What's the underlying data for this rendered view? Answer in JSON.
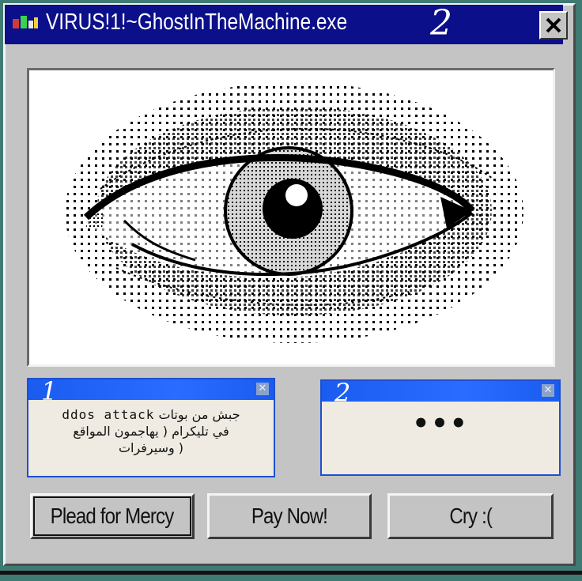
{
  "window": {
    "title": "VIRUS!1!~GhostInTheMachine.exe",
    "title_number": "2",
    "close_label": "✕"
  },
  "icons": {
    "app": "app-icon",
    "close": "close-icon",
    "eye": "eye-image"
  },
  "messages": [
    {
      "number": "1",
      "close": "✕",
      "line1_latin": "ddos attack",
      "line1_arabic": "جبش من بوتات",
      "line2": "في تليكرام ( يهاجمون المواقع",
      "line3": "وسيرفرات )"
    },
    {
      "number": "2",
      "close": "✕",
      "text": "•••"
    }
  ],
  "buttons": {
    "plead": "Plead for Mercy",
    "pay": "Pay Now!",
    "cry": "Cry :("
  },
  "colors": {
    "desktop": "#3f7a73",
    "titlebar": "#0c0f8a",
    "window": "#c4c4c4",
    "message_bar": "#1a5cf0"
  }
}
